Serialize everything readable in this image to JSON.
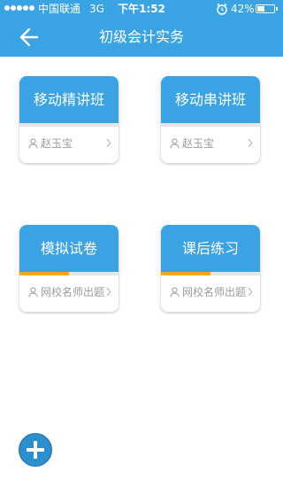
{
  "status_bar": {
    "carrier": "中国联通",
    "network": "3G",
    "time": "下午1:52",
    "battery_percent": "42%",
    "battery_level": 0.42
  },
  "header": {
    "title": "初级会计实务",
    "back_icon": "arrow-left-icon"
  },
  "cards": [
    {
      "title": "移动精讲班",
      "author": "赵玉宝",
      "progress": 0
    },
    {
      "title": "移动串讲班",
      "author": "赵玉宝",
      "progress": 0
    },
    {
      "title": "模拟试卷",
      "author": "网校名师出题",
      "progress": 0.5
    },
    {
      "title": "课后练习",
      "author": "网校名师出题",
      "progress": 0.5
    }
  ],
  "colors": {
    "primary": "#3aa3e3",
    "progress": "#f0a61e",
    "muted_text": "#9c9c9c"
  },
  "add_button": {
    "icon": "plus-icon"
  }
}
